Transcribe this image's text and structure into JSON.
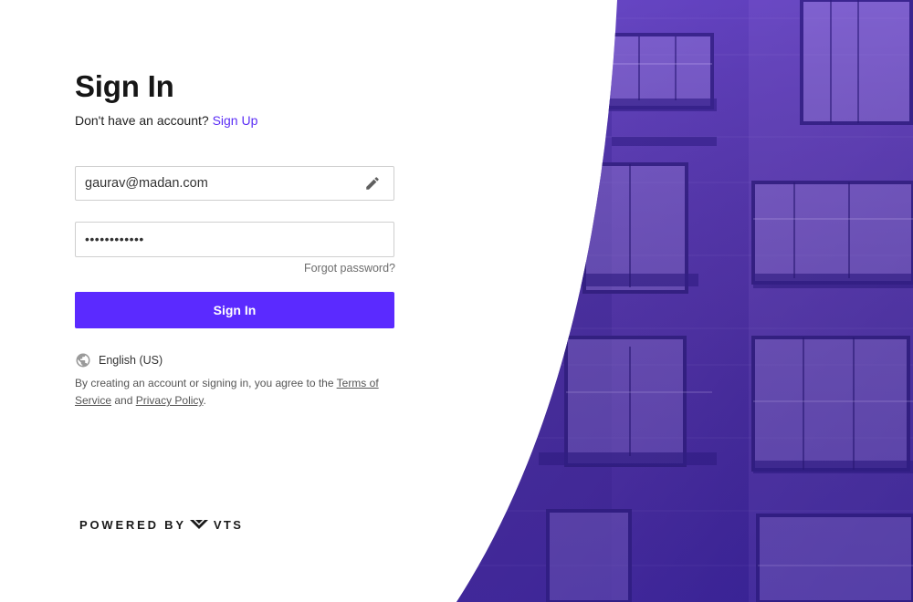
{
  "page": {
    "title": "Sign In",
    "subtitle_prefix": "Don't have an account?",
    "signup_link": "Sign Up"
  },
  "form": {
    "email_value": "gaurav@madan.com",
    "password_value": "••••••••••••",
    "edit_icon": "pencil-icon",
    "forgot_password": "Forgot password?",
    "submit_label": "Sign In"
  },
  "language": {
    "icon": "globe-icon",
    "label": "English (US)"
  },
  "legal": {
    "prefix": "By creating an account or signing in, you agree to the",
    "terms": "Terms of Service",
    "and": "and",
    "privacy": "Privacy Policy",
    "suffix": "."
  },
  "footer": {
    "powered_by": "POWERED BY",
    "brand": "VTS"
  },
  "colors": {
    "accent": "#5B2AFF",
    "link": "#5B2EF5",
    "hero_overlay": "#6A43C9"
  }
}
